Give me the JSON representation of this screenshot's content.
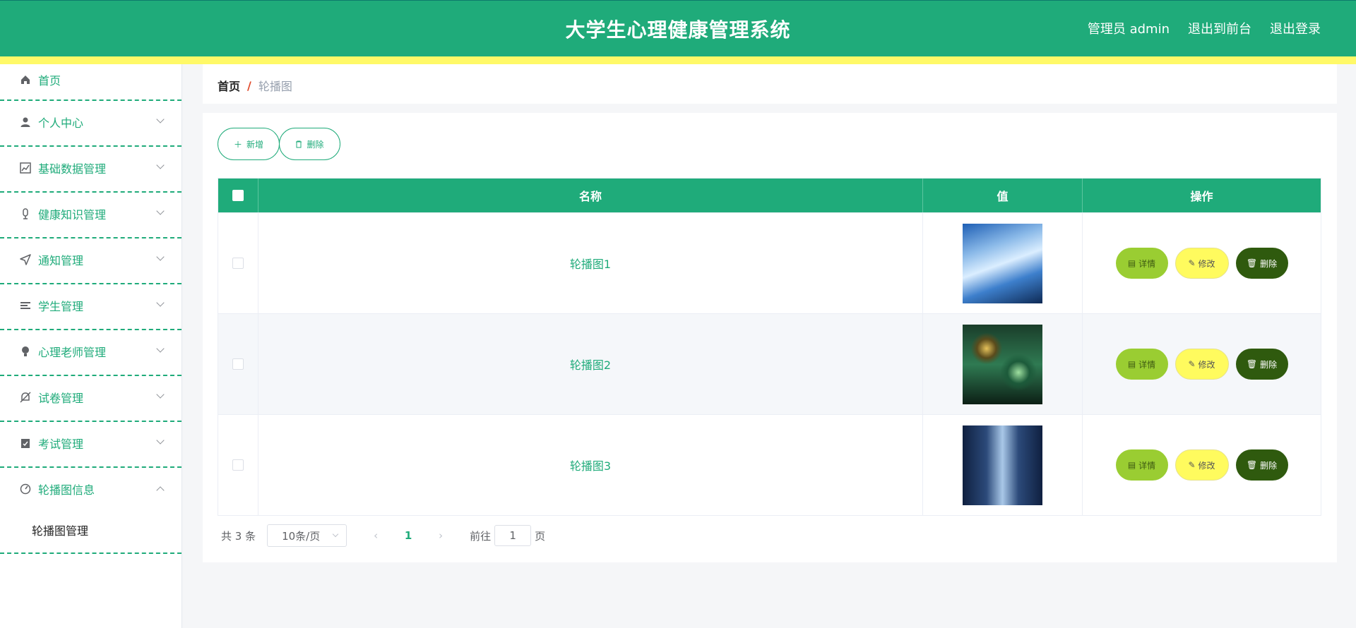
{
  "header": {
    "title": "大学生心理健康管理系统",
    "links": [
      "管理员 admin",
      "退出到前台",
      "退出登录"
    ]
  },
  "sidebar": {
    "items": [
      {
        "label": "首页",
        "icon": "home-icon"
      },
      {
        "label": "个人中心",
        "icon": "user-icon"
      },
      {
        "label": "基础数据管理",
        "icon": "chart-icon"
      },
      {
        "label": "健康知识管理",
        "icon": "mic-icon"
      },
      {
        "label": "通知管理",
        "icon": "send-icon"
      },
      {
        "label": "学生管理",
        "icon": "list-icon"
      },
      {
        "label": "心理老师管理",
        "icon": "bulb-icon"
      },
      {
        "label": "试卷管理",
        "icon": "bell-off-icon"
      },
      {
        "label": "考试管理",
        "icon": "clipboard-icon"
      },
      {
        "label": "轮播图信息",
        "icon": "gauge-icon"
      }
    ],
    "submenu": {
      "label": "轮播图管理"
    }
  },
  "breadcrumb": {
    "home": "首页",
    "separator": "/",
    "current": "轮播图"
  },
  "toolbar": {
    "add_label": "新增",
    "delete_label": "删除"
  },
  "table": {
    "columns": [
      "名称",
      "值",
      "操作"
    ],
    "rows": [
      {
        "name": "轮播图1"
      },
      {
        "name": "轮播图2"
      },
      {
        "name": "轮播图3"
      }
    ],
    "actions": {
      "detail": "详情",
      "edit": "修改",
      "delete": "删除"
    }
  },
  "pagination": {
    "total": "共 3 条",
    "page_size": "10条/页",
    "current_page": "1",
    "goto_label": "前往",
    "goto_value": "1",
    "page_suffix": "页"
  },
  "colors": {
    "primary": "#1fab7a",
    "accent_bar": "#fff968",
    "detail": "#9acd32",
    "edit": "#fffb5e",
    "delete": "#2f5a0e"
  }
}
